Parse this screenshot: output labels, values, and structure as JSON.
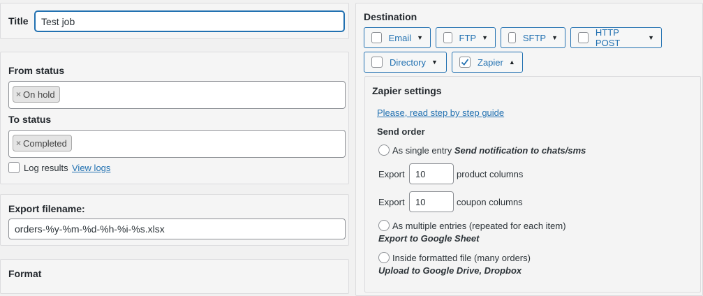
{
  "title_section": {
    "label": "Title",
    "value": "Test job"
  },
  "status_section": {
    "from_label": "From status",
    "from_tags": [
      "On hold"
    ],
    "to_label": "To status",
    "to_tags": [
      "Completed"
    ],
    "log_results_label": "Log results",
    "view_logs_link": "View logs",
    "tag_remove_symbol": "×"
  },
  "export_filename": {
    "label": "Export filename:",
    "value": "orders-%y-%m-%d-%h-%i-%s.xlsx"
  },
  "format_section": {
    "label": "Format"
  },
  "destination": {
    "label": "Destination",
    "buttons": [
      {
        "label": "Email",
        "checked": false,
        "caret": "▼"
      },
      {
        "label": "FTP",
        "checked": false,
        "caret": "▼"
      },
      {
        "label": "SFTP",
        "checked": false,
        "caret": "▼"
      },
      {
        "label": "HTTP POST",
        "checked": false,
        "caret": "▼"
      },
      {
        "label": "Directory",
        "checked": false,
        "caret": "▼"
      },
      {
        "label": "Zapier",
        "checked": true,
        "caret": "▲"
      }
    ]
  },
  "zapier": {
    "title": "Zapier settings",
    "guide_link": "Please, read step by step guide",
    "send_order_label": "Send order",
    "options": {
      "single_entry": {
        "label": "As single entry",
        "note": "Send notification to chats/sms"
      },
      "export_label": "Export",
      "product_columns_value": "10",
      "product_columns_label": "product columns",
      "coupon_columns_value": "10",
      "coupon_columns_label": "coupon columns",
      "multiple_entries": {
        "label": "As multiple entries (repeated for each item)",
        "note": "Export to Google Sheet"
      },
      "formatted_file": {
        "label": "Inside formatted file (many orders)",
        "note": "Upload to Google Drive, Dropbox"
      }
    }
  },
  "colors": {
    "accent": "#2271b1",
    "panel_bg": "#f5f5f5",
    "page_bg": "#f1f1f1"
  }
}
